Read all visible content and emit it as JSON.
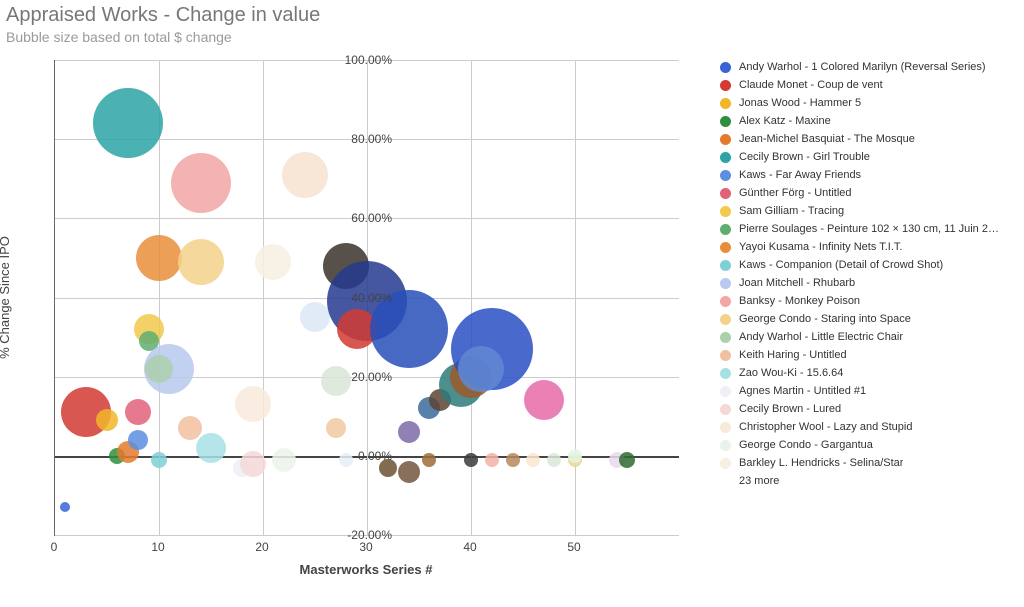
{
  "title": "Appraised Works - Change in value",
  "subtitle": "Bubble size based on total $ change",
  "xlabel": "Masterworks Series #",
  "ylabel": "% Change Since IPO",
  "legend_more": "23 more",
  "chart_data": {
    "type": "scatter",
    "xlabel": "Masterworks Series #",
    "ylabel": "% Change Since IPO",
    "xlim": [
      0,
      60
    ],
    "ylim": [
      -20,
      100
    ],
    "xticks": [
      0,
      10,
      20,
      30,
      40,
      50
    ],
    "yticks": [
      -20,
      0,
      20,
      40,
      60,
      80,
      100
    ],
    "ytick_labels": [
      "-20.00%",
      "0.00%",
      "20.00%",
      "40.00%",
      "60.00%",
      "80.00%",
      "100.00%"
    ],
    "bubble_size_encodes": "total $ change",
    "series": [
      {
        "name": "Andy Warhol - 1 Colored Marilyn (Reversal Series)",
        "color": "#3a63d6",
        "x": 1,
        "y": -13,
        "s": 10
      },
      {
        "name": "Claude Monet - Coup de vent",
        "color": "#d23a33",
        "x": 3,
        "y": 11,
        "s": 50
      },
      {
        "name": "Jonas Wood - Hammer 5",
        "color": "#f1b52a",
        "x": 5,
        "y": 9,
        "s": 22
      },
      {
        "name": "Alex Katz - Maxine",
        "color": "#2f8f3c",
        "x": 6,
        "y": 0,
        "s": 16
      },
      {
        "name": "Jean-Michel Basquiat - The Mosque",
        "color": "#e47a2e",
        "x": 7,
        "y": 1,
        "s": 22
      },
      {
        "name": "Cecily Brown - Girl Trouble",
        "color": "#2ca3a6",
        "x": 7,
        "y": 84,
        "s": 70
      },
      {
        "name": "Kaws - Far Away Friends",
        "color": "#5b8fe0",
        "x": 8,
        "y": 4,
        "s": 20
      },
      {
        "name": "Günther Förg - Untitled",
        "color": "#e2627a",
        "x": 8,
        "y": 11,
        "s": 26
      },
      {
        "name": "Sam Gilliam - Tracing",
        "color": "#f2c94c",
        "x": 9,
        "y": 32,
        "s": 30
      },
      {
        "name": "Pierre Soulages - Peinture 102 × 130 cm, 11 Juin 2…",
        "color": "#5fae70",
        "x": 9,
        "y": 29,
        "s": 20
      },
      {
        "name": "Yayoi Kusama - Infinity Nets T.I.T.",
        "color": "#e88e3a",
        "x": 10,
        "y": 50,
        "s": 46
      },
      {
        "name": "Kaws - Companion (Detail of Crowd Shot)",
        "color": "#7fd0d6",
        "x": 10,
        "y": -1,
        "s": 16
      },
      {
        "name": "Joan Mitchell - Rhubarb",
        "color": "#b8c9ef",
        "x": 11,
        "y": 22,
        "s": 50
      },
      {
        "name": "Banksy - Monkey Poison",
        "color": "#f2a6a6",
        "x": 14,
        "y": 69,
        "s": 60
      },
      {
        "name": "George Condo - Staring into Space",
        "color": "#f3d28b",
        "x": 14,
        "y": 49,
        "s": 46
      },
      {
        "name": "Andy Warhol - Little Electric Chair",
        "color": "#abd0ab",
        "x": 10,
        "y": 22,
        "s": 28
      },
      {
        "name": "Keith Haring - Untitled",
        "color": "#f2bfa0",
        "x": 13,
        "y": 7,
        "s": 24
      },
      {
        "name": "Zao Wou-Ki - 15.6.64",
        "color": "#a7e0e4",
        "x": 15,
        "y": 2,
        "s": 30
      },
      {
        "name": "Agnes Martin - Untitled #1",
        "color": "#eef0f6",
        "x": 18,
        "y": -3,
        "s": 18
      },
      {
        "name": "Cecily Brown - Lured",
        "color": "#f6d8d8",
        "x": 19,
        "y": -2,
        "s": 26
      },
      {
        "name": "Christopher Wool - Lazy and Stupid",
        "color": "#f7eadb",
        "x": 19,
        "y": 13,
        "s": 36
      },
      {
        "name": "George Condo - Gargantua",
        "color": "#eaf3ea",
        "x": 22,
        "y": -1,
        "s": 24
      },
      {
        "name": "Barkley L. Hendricks - Selina/Star",
        "color": "#f6efe2",
        "x": 21,
        "y": 49,
        "s": 36
      },
      {
        "name": "",
        "color": "#f7e2d0",
        "x": 24,
        "y": 71,
        "s": 46
      },
      {
        "name": "",
        "color": "#dce8f7",
        "x": 25,
        "y": 35,
        "s": 30
      },
      {
        "name": "",
        "color": "#3b322b",
        "x": 28,
        "y": 48,
        "s": 46
      },
      {
        "name": "",
        "color": "#243a8f",
        "x": 30,
        "y": 39,
        "s": 80
      },
      {
        "name": "",
        "color": "#d23a33",
        "x": 29,
        "y": 32,
        "s": 40
      },
      {
        "name": "",
        "color": "#d7e6d7",
        "x": 27,
        "y": 19,
        "s": 30
      },
      {
        "name": "",
        "color": "#f2c9a0",
        "x": 27,
        "y": 7,
        "s": 20
      },
      {
        "name": "",
        "color": "#e8eef7",
        "x": 28,
        "y": -1,
        "s": 14
      },
      {
        "name": "",
        "color": "#6b5132",
        "x": 32,
        "y": -3,
        "s": 18
      },
      {
        "name": "",
        "color": "#284fb8",
        "x": 34,
        "y": 32,
        "s": 78
      },
      {
        "name": "",
        "color": "#7e6aa6",
        "x": 34,
        "y": 6,
        "s": 22
      },
      {
        "name": "",
        "color": "#72563e",
        "x": 34,
        "y": -4,
        "s": 22
      },
      {
        "name": "",
        "color": "#3a6b9c",
        "x": 36,
        "y": 12,
        "s": 22
      },
      {
        "name": "",
        "color": "#9d6d3a",
        "x": 36,
        "y": -1,
        "s": 14
      },
      {
        "name": "",
        "color": "#5c4433",
        "x": 37,
        "y": 14,
        "s": 22
      },
      {
        "name": "",
        "color": "#2e7a7a",
        "x": 39,
        "y": 18,
        "s": 44
      },
      {
        "name": "",
        "color": "#3b3b3b",
        "x": 40,
        "y": -1,
        "s": 14
      },
      {
        "name": "",
        "color": "#9c5a2a",
        "x": 40,
        "y": 20,
        "s": 42
      },
      {
        "name": "",
        "color": "#2a4fc4",
        "x": 42,
        "y": 27,
        "s": 82
      },
      {
        "name": "",
        "color": "#6288d2",
        "x": 41,
        "y": 22,
        "s": 46
      },
      {
        "name": "",
        "color": "#f1b3a6",
        "x": 42,
        "y": -1,
        "s": 14
      },
      {
        "name": "",
        "color": "#b58a5a",
        "x": 44,
        "y": -1,
        "s": 14
      },
      {
        "name": "",
        "color": "#f9e6cf",
        "x": 46,
        "y": -1,
        "s": 14
      },
      {
        "name": "",
        "color": "#e86aa8",
        "x": 47,
        "y": 14,
        "s": 40
      },
      {
        "name": "",
        "color": "#d8e8d8",
        "x": 48,
        "y": -1,
        "s": 14
      },
      {
        "name": "",
        "color": "#e8d890",
        "x": 50,
        "y": -1,
        "s": 14
      },
      {
        "name": "",
        "color": "#e5f5e5",
        "x": 50,
        "y": 0,
        "s": 14
      },
      {
        "name": "",
        "color": "#e7d9f0",
        "x": 54,
        "y": -1,
        "s": 16
      },
      {
        "name": "",
        "color": "#2f6b2f",
        "x": 55,
        "y": -1,
        "s": 16
      }
    ]
  }
}
